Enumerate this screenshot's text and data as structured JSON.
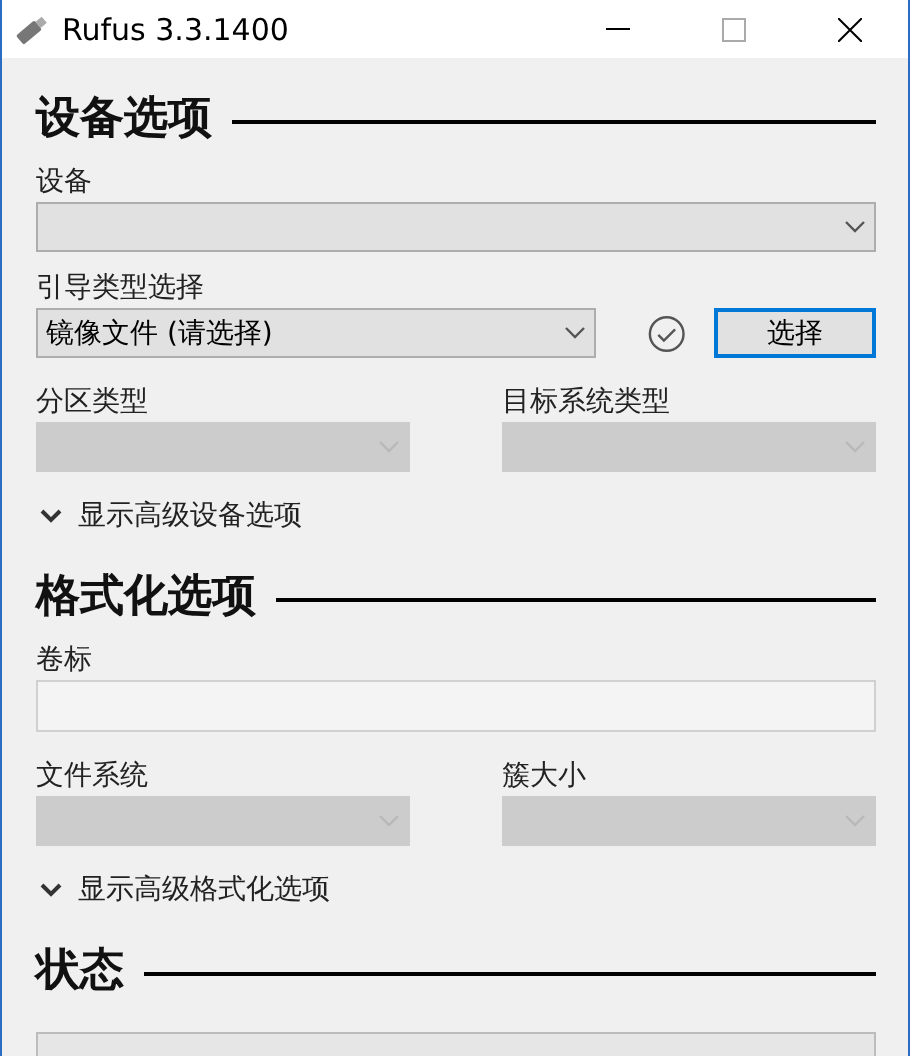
{
  "window": {
    "title": "Rufus 3.3.1400"
  },
  "sections": [
    {
      "heading": "设备选项",
      "rows": [
        {
          "kind": "dropdown",
          "label": "设备",
          "disabled": false
        },
        {
          "kind": "boot",
          "label": "引导类型选择",
          "value": "镜像文件 (请选择)",
          "disabled": false,
          "button": "选择"
        },
        {
          "kind": "pair",
          "items": [
            {
              "label": "分区类型",
              "disabled": true
            },
            {
              "label": "目标系统类型",
              "disabled": true
            }
          ]
        }
      ],
      "toggle": {
        "label": "显示高级设备选项",
        "expanded": false
      }
    },
    {
      "heading": "格式化选项",
      "rows": [
        {
          "kind": "input",
          "label": "卷标"
        },
        {
          "kind": "pair",
          "items": [
            {
              "label": "文件系统",
              "disabled": true
            },
            {
              "label": "簇大小",
              "disabled": true
            }
          ]
        }
      ],
      "toggle": {
        "label": "显示高级格式化选项",
        "expanded": false
      }
    },
    {
      "heading": "状态",
      "rows": [
        {
          "kind": "progress"
        }
      ]
    }
  ]
}
